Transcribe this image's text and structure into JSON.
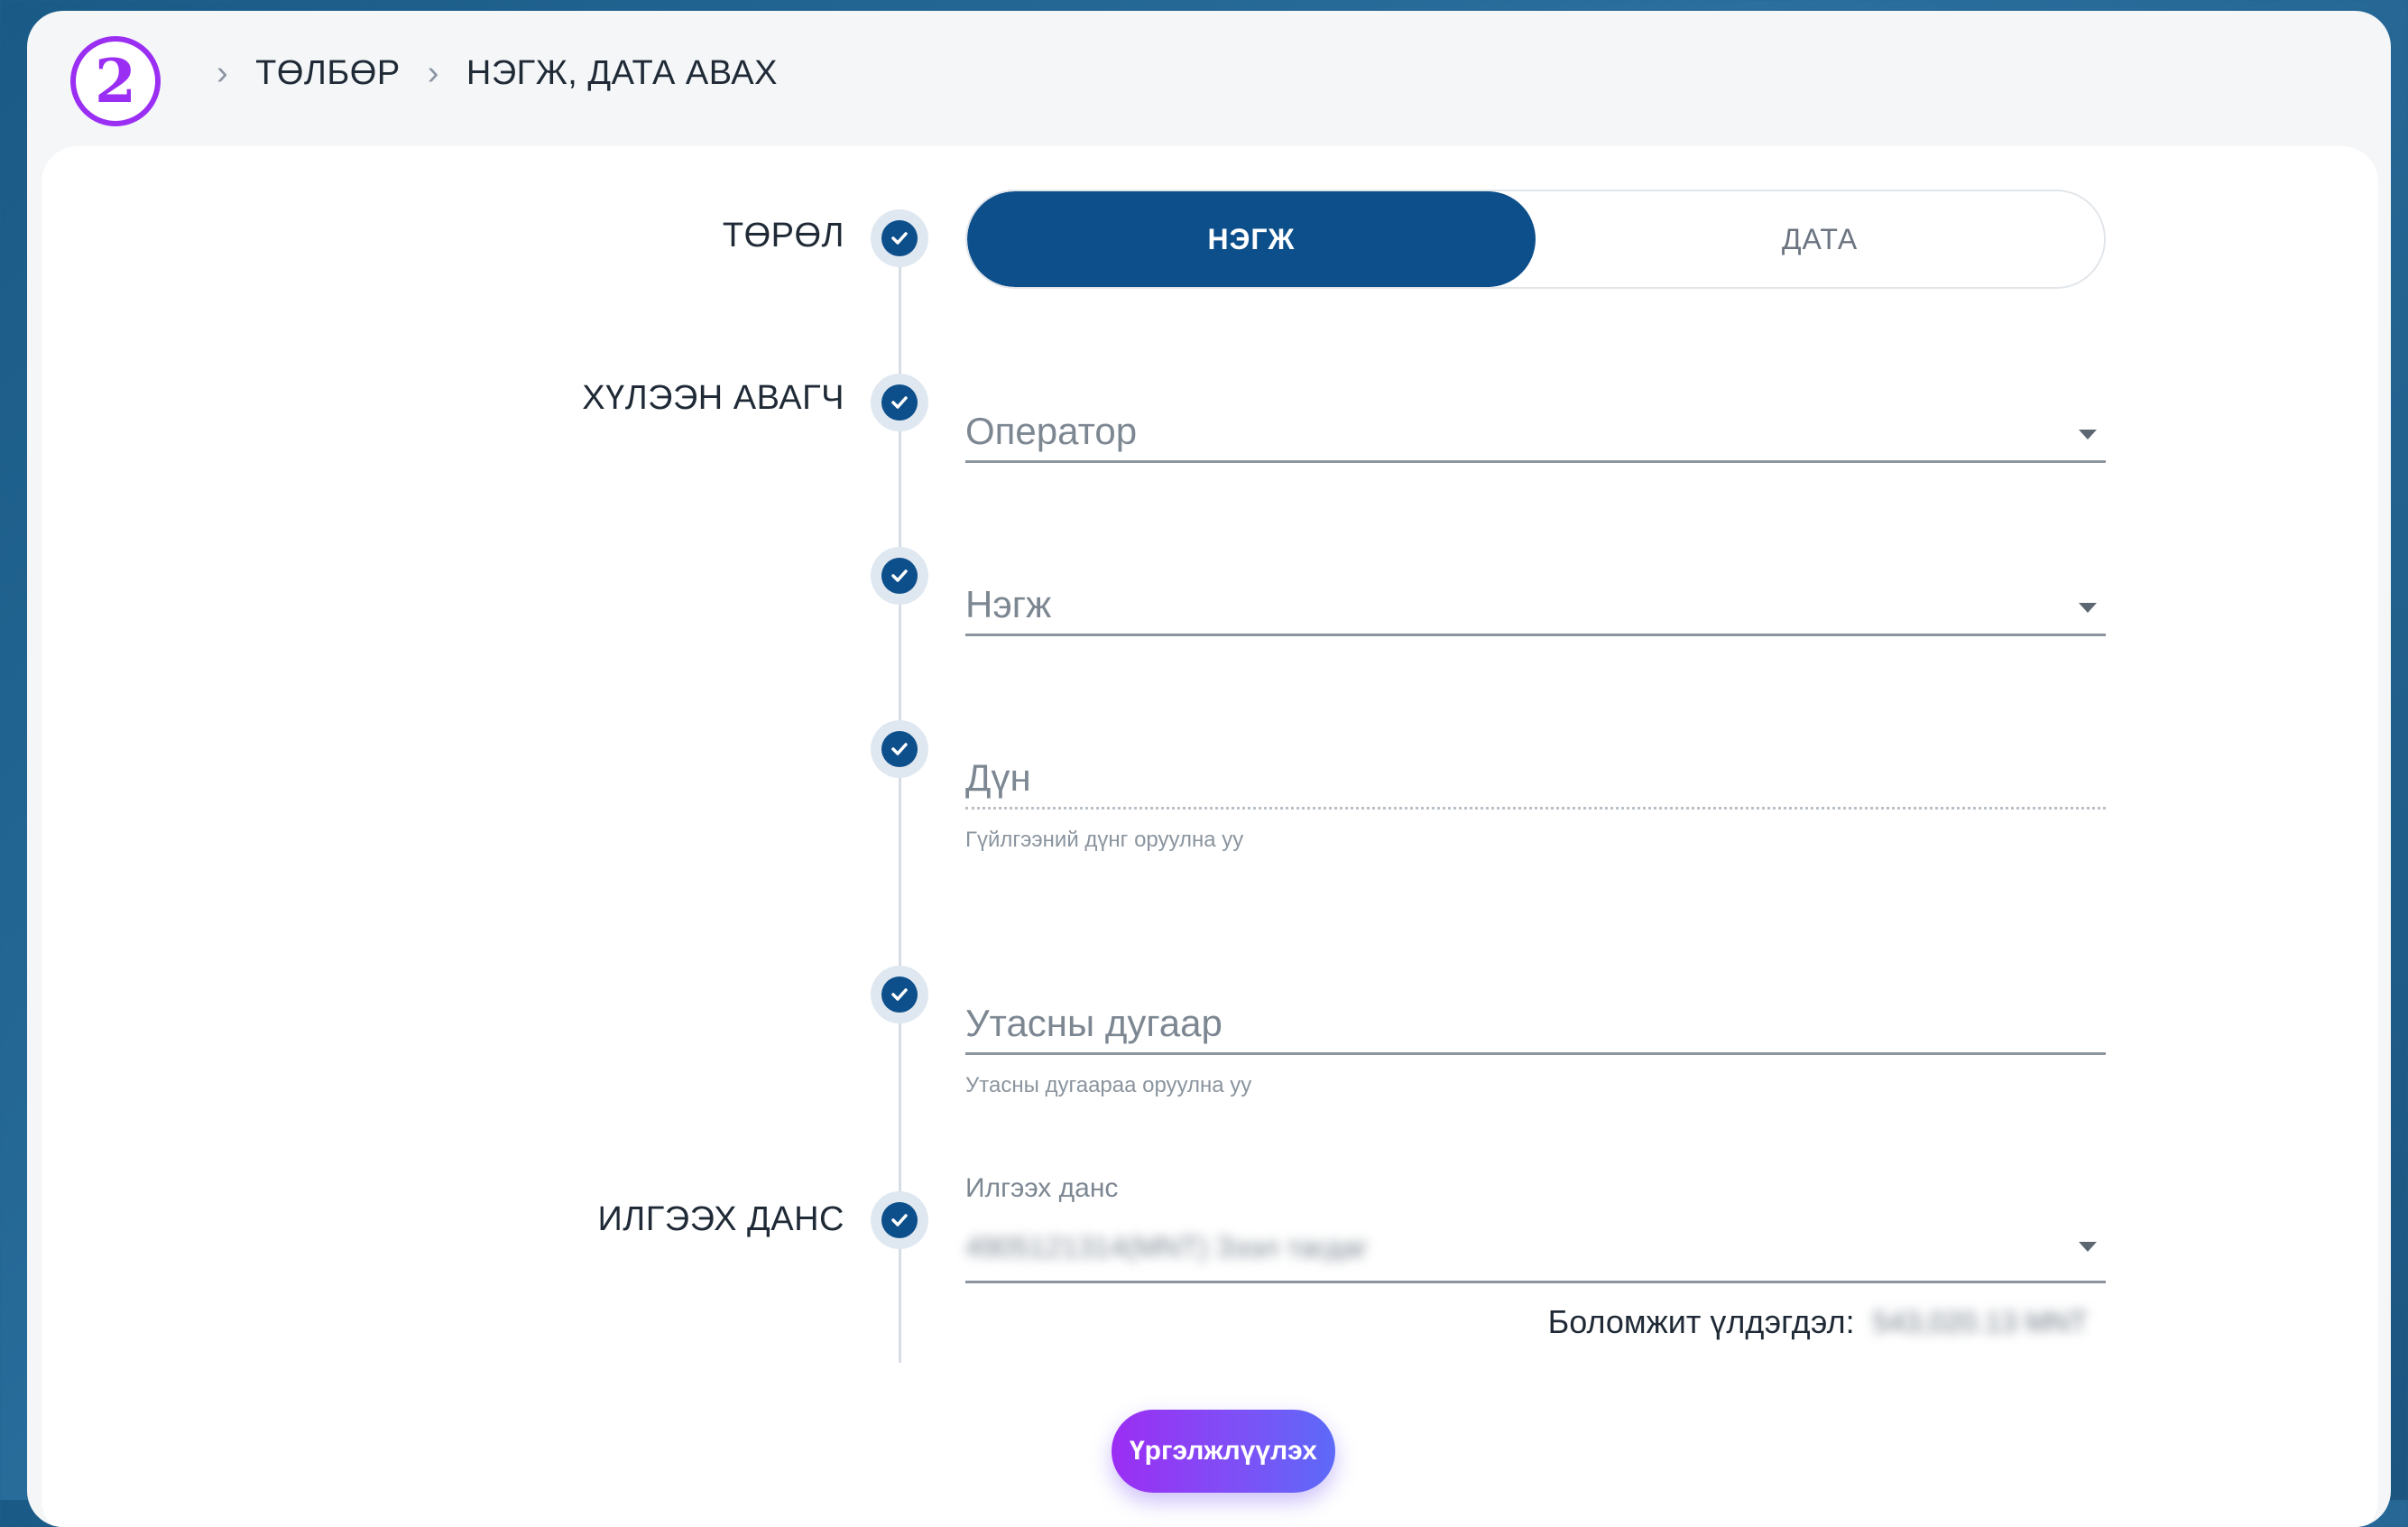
{
  "breadcrumb": {
    "step_number": "2",
    "items": [
      "ТӨЛБӨР",
      "НЭГЖ, ДАТА АВАХ"
    ]
  },
  "form": {
    "type_label": "ТӨРӨЛ",
    "type_options": [
      {
        "label": "НЭГЖ",
        "selected": true
      },
      {
        "label": "ДАТА",
        "selected": false
      }
    ],
    "recipient_label": "ХҮЛЭЭН АВАГЧ",
    "operator_placeholder": "Оператор",
    "unit_placeholder": "Нэгж",
    "amount_placeholder": "Дүн",
    "amount_hint": "Гүйлгээний дүнг оруулна уу",
    "phone_placeholder": "Утасны дугаар",
    "phone_hint": "Утасны дугаараа оруулна уу",
    "account_section_label": "ИЛГЭЭХ ДАНС",
    "account_field_label": "Илгээх данс",
    "account_value": "4905121314(MNT) Зээл тагдаг",
    "balance_label": "Боломжит үлдэгдэл:",
    "balance_value": "543,020.13  MNT",
    "continue_label": "Үргэлжлүүлэх"
  },
  "colors": {
    "primary": "#0d4f8b",
    "accent": "#9b2ef3",
    "background": "#1a5a86"
  }
}
